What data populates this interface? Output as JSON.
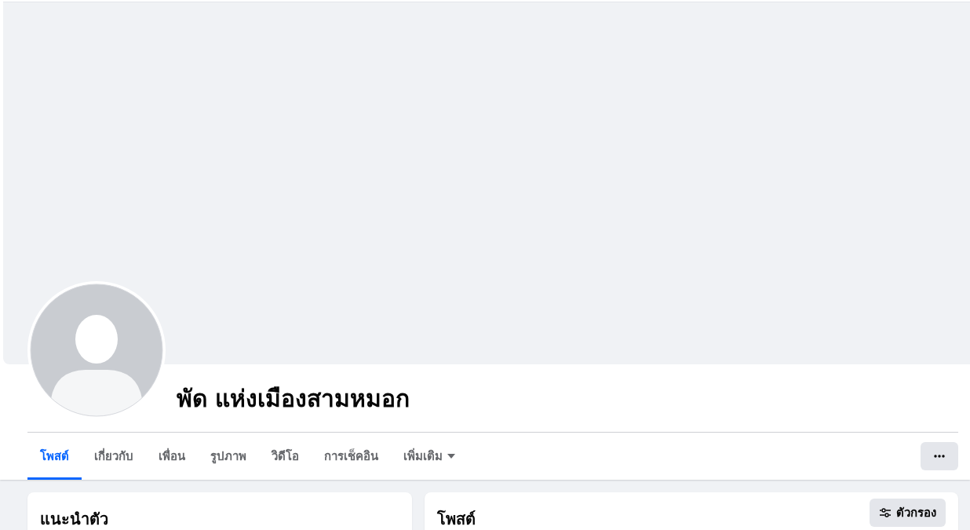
{
  "profile": {
    "name": "พัด แห่งเมืองสามหมอก"
  },
  "tabs": [
    {
      "label": "โพสต์",
      "selected": true,
      "kind": "tab"
    },
    {
      "label": "เกี่ยวกับ",
      "selected": false,
      "kind": "tab"
    },
    {
      "label": "เพื่อน",
      "selected": false,
      "kind": "tab"
    },
    {
      "label": "รูปภาพ",
      "selected": false,
      "kind": "tab"
    },
    {
      "label": "วิดีโอ",
      "selected": false,
      "kind": "tab"
    },
    {
      "label": "การเช็คอิน",
      "selected": false,
      "kind": "tab"
    },
    {
      "label": "เพิ่มเติม",
      "selected": false,
      "kind": "dropdown"
    }
  ],
  "intro_card": {
    "title": "แนะนำตัว"
  },
  "posts_card": {
    "title": "โพสต์",
    "filter_button": "ตัวกรอง"
  }
}
